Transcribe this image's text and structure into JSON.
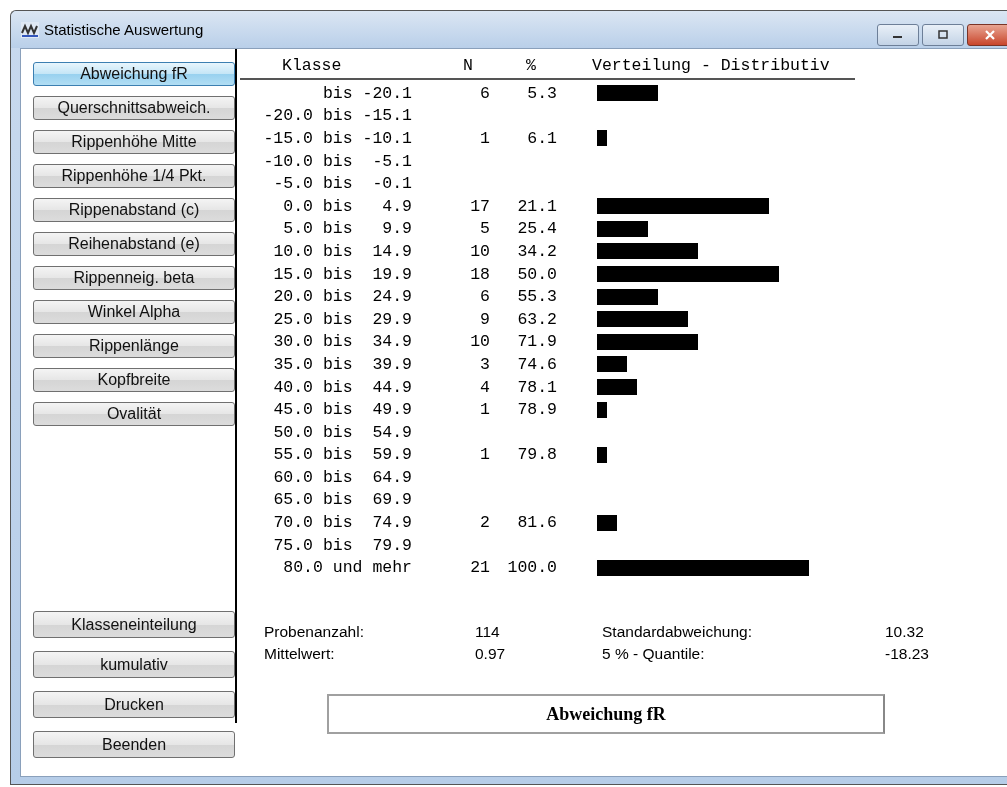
{
  "window": {
    "title": "Statistische Auswertung"
  },
  "measure_buttons": [
    {
      "label": "Abweichung fR",
      "selected": true
    },
    {
      "label": "Querschnittsabweich.",
      "selected": false
    },
    {
      "label": "Rippenhöhe Mitte",
      "selected": false
    },
    {
      "label": "Rippenhöhe 1/4 Pkt.",
      "selected": false
    },
    {
      "label": "Rippenabstand (c)",
      "selected": false
    },
    {
      "label": "Reihenabstand (e)",
      "selected": false
    },
    {
      "label": "Rippenneig. beta",
      "selected": false
    },
    {
      "label": "Winkel Alpha",
      "selected": false
    },
    {
      "label": "Rippenlänge",
      "selected": false
    },
    {
      "label": "Kopfbreite",
      "selected": false
    },
    {
      "label": "Ovalität",
      "selected": false
    }
  ],
  "action_buttons": [
    "Klasseneinteilung",
    "kumulativ",
    "Drucken",
    "Beenden"
  ],
  "table": {
    "columns": [
      "Klasse",
      "N",
      "%",
      "Verteilung - Distributiv"
    ],
    "rows": [
      {
        "class": "bis -20.1",
        "n": "6",
        "percent": "5.3"
      },
      {
        "class": "-20.0 bis -15.1"
      },
      {
        "class": "-15.0 bis -10.1",
        "n": "1",
        "percent": "6.1"
      },
      {
        "class": "-10.0 bis  -5.1"
      },
      {
        "class": "-5.0 bis  -0.1"
      },
      {
        "class": "0.0 bis   4.9",
        "n": "17",
        "percent": "21.1"
      },
      {
        "class": "5.0 bis   9.9",
        "n": "5",
        "percent": "25.4"
      },
      {
        "class": "10.0 bis  14.9",
        "n": "10",
        "percent": "34.2"
      },
      {
        "class": "15.0 bis  19.9",
        "n": "18",
        "percent": "50.0"
      },
      {
        "class": "20.0 bis  24.9",
        "n": "6",
        "percent": "55.3"
      },
      {
        "class": "25.0 bis  29.9",
        "n": "9",
        "percent": "63.2"
      },
      {
        "class": "30.0 bis  34.9",
        "n": "10",
        "percent": "71.9"
      },
      {
        "class": "35.0 bis  39.9",
        "n": "3",
        "percent": "74.6"
      },
      {
        "class": "40.0 bis  44.9",
        "n": "4",
        "percent": "78.1"
      },
      {
        "class": "45.0 bis  49.9",
        "n": "1",
        "percent": "78.9"
      },
      {
        "class": "50.0 bis  54.9"
      },
      {
        "class": "55.0 bis  59.9",
        "n": "1",
        "percent": "79.8"
      },
      {
        "class": "60.0 bis  64.9"
      },
      {
        "class": "65.0 bis  69.9"
      },
      {
        "class": "70.0 bis  74.9",
        "n": "2",
        "percent": "81.6"
      },
      {
        "class": "75.0 bis  79.9"
      },
      {
        "class": "80.0 und mehr",
        "n": "21",
        "percent": "100.0"
      }
    ]
  },
  "summary": [
    {
      "label": "Probenanzahl:",
      "value": "114"
    },
    {
      "label": "Standardabweichung:",
      "value": "10.32"
    },
    {
      "label": "Mittelwert:",
      "value": "0.97"
    },
    {
      "label": "5 % - Quantile:",
      "value": "-18.23"
    }
  ],
  "chart_title": "Abweichung fR"
}
